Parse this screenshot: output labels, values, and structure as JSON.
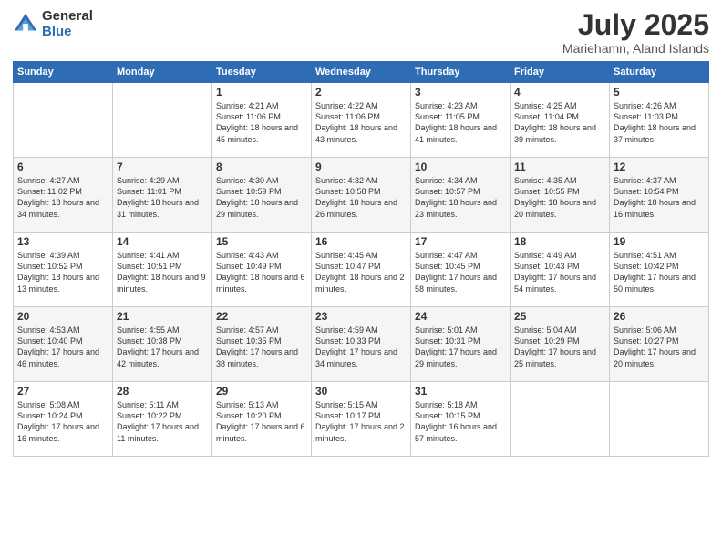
{
  "logo": {
    "general": "General",
    "blue": "Blue"
  },
  "title": "July 2025",
  "location": "Mariehamn, Aland Islands",
  "days_of_week": [
    "Sunday",
    "Monday",
    "Tuesday",
    "Wednesday",
    "Thursday",
    "Friday",
    "Saturday"
  ],
  "weeks": [
    [
      {
        "num": "",
        "content": ""
      },
      {
        "num": "",
        "content": ""
      },
      {
        "num": "1",
        "content": "Sunrise: 4:21 AM\nSunset: 11:06 PM\nDaylight: 18 hours and 45 minutes."
      },
      {
        "num": "2",
        "content": "Sunrise: 4:22 AM\nSunset: 11:06 PM\nDaylight: 18 hours and 43 minutes."
      },
      {
        "num": "3",
        "content": "Sunrise: 4:23 AM\nSunset: 11:05 PM\nDaylight: 18 hours and 41 minutes."
      },
      {
        "num": "4",
        "content": "Sunrise: 4:25 AM\nSunset: 11:04 PM\nDaylight: 18 hours and 39 minutes."
      },
      {
        "num": "5",
        "content": "Sunrise: 4:26 AM\nSunset: 11:03 PM\nDaylight: 18 hours and 37 minutes."
      }
    ],
    [
      {
        "num": "6",
        "content": "Sunrise: 4:27 AM\nSunset: 11:02 PM\nDaylight: 18 hours and 34 minutes."
      },
      {
        "num": "7",
        "content": "Sunrise: 4:29 AM\nSunset: 11:01 PM\nDaylight: 18 hours and 31 minutes."
      },
      {
        "num": "8",
        "content": "Sunrise: 4:30 AM\nSunset: 10:59 PM\nDaylight: 18 hours and 29 minutes."
      },
      {
        "num": "9",
        "content": "Sunrise: 4:32 AM\nSunset: 10:58 PM\nDaylight: 18 hours and 26 minutes."
      },
      {
        "num": "10",
        "content": "Sunrise: 4:34 AM\nSunset: 10:57 PM\nDaylight: 18 hours and 23 minutes."
      },
      {
        "num": "11",
        "content": "Sunrise: 4:35 AM\nSunset: 10:55 PM\nDaylight: 18 hours and 20 minutes."
      },
      {
        "num": "12",
        "content": "Sunrise: 4:37 AM\nSunset: 10:54 PM\nDaylight: 18 hours and 16 minutes."
      }
    ],
    [
      {
        "num": "13",
        "content": "Sunrise: 4:39 AM\nSunset: 10:52 PM\nDaylight: 18 hours and 13 minutes."
      },
      {
        "num": "14",
        "content": "Sunrise: 4:41 AM\nSunset: 10:51 PM\nDaylight: 18 hours and 9 minutes."
      },
      {
        "num": "15",
        "content": "Sunrise: 4:43 AM\nSunset: 10:49 PM\nDaylight: 18 hours and 6 minutes."
      },
      {
        "num": "16",
        "content": "Sunrise: 4:45 AM\nSunset: 10:47 PM\nDaylight: 18 hours and 2 minutes."
      },
      {
        "num": "17",
        "content": "Sunrise: 4:47 AM\nSunset: 10:45 PM\nDaylight: 17 hours and 58 minutes."
      },
      {
        "num": "18",
        "content": "Sunrise: 4:49 AM\nSunset: 10:43 PM\nDaylight: 17 hours and 54 minutes."
      },
      {
        "num": "19",
        "content": "Sunrise: 4:51 AM\nSunset: 10:42 PM\nDaylight: 17 hours and 50 minutes."
      }
    ],
    [
      {
        "num": "20",
        "content": "Sunrise: 4:53 AM\nSunset: 10:40 PM\nDaylight: 17 hours and 46 minutes."
      },
      {
        "num": "21",
        "content": "Sunrise: 4:55 AM\nSunset: 10:38 PM\nDaylight: 17 hours and 42 minutes."
      },
      {
        "num": "22",
        "content": "Sunrise: 4:57 AM\nSunset: 10:35 PM\nDaylight: 17 hours and 38 minutes."
      },
      {
        "num": "23",
        "content": "Sunrise: 4:59 AM\nSunset: 10:33 PM\nDaylight: 17 hours and 34 minutes."
      },
      {
        "num": "24",
        "content": "Sunrise: 5:01 AM\nSunset: 10:31 PM\nDaylight: 17 hours and 29 minutes."
      },
      {
        "num": "25",
        "content": "Sunrise: 5:04 AM\nSunset: 10:29 PM\nDaylight: 17 hours and 25 minutes."
      },
      {
        "num": "26",
        "content": "Sunrise: 5:06 AM\nSunset: 10:27 PM\nDaylight: 17 hours and 20 minutes."
      }
    ],
    [
      {
        "num": "27",
        "content": "Sunrise: 5:08 AM\nSunset: 10:24 PM\nDaylight: 17 hours and 16 minutes."
      },
      {
        "num": "28",
        "content": "Sunrise: 5:11 AM\nSunset: 10:22 PM\nDaylight: 17 hours and 11 minutes."
      },
      {
        "num": "29",
        "content": "Sunrise: 5:13 AM\nSunset: 10:20 PM\nDaylight: 17 hours and 6 minutes."
      },
      {
        "num": "30",
        "content": "Sunrise: 5:15 AM\nSunset: 10:17 PM\nDaylight: 17 hours and 2 minutes."
      },
      {
        "num": "31",
        "content": "Sunrise: 5:18 AM\nSunset: 10:15 PM\nDaylight: 16 hours and 57 minutes."
      },
      {
        "num": "",
        "content": ""
      },
      {
        "num": "",
        "content": ""
      }
    ]
  ]
}
